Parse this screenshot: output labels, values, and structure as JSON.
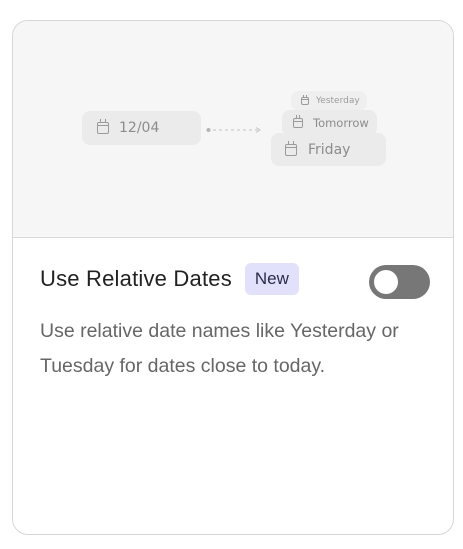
{
  "preview": {
    "source_date": "12/04",
    "relative_options": [
      "Yesterday",
      "Tomorrow",
      "Friday"
    ],
    "icon": "calendar-icon"
  },
  "setting": {
    "title": "Use Relative Dates",
    "badge": "New",
    "description": "Use relative date names like Yesterday or Tuesday for dates close to today.",
    "enabled": false
  },
  "colors": {
    "toggle_track": "#777777",
    "badge_bg": "#e2e1fb",
    "preview_bg": "#f6f6f6"
  }
}
